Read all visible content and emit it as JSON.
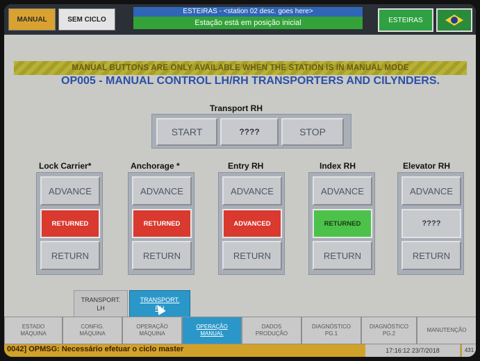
{
  "topbar": {
    "manual_label": "MANUAL",
    "sem_ciclo_label": "SEM CICLO",
    "title_line1": "ESTEIRAS - <station 02 desc. goes here>",
    "title_line2": "Estação está em posição inicial",
    "esteiras_label": "ESTEIRAS",
    "flag_icon": "brazil-flag-icon"
  },
  "warning": "MANUAL BUTTONS ARE ONLY AVAILABLE WHEN THE STATION IS IN MANUAL MODE",
  "page_title": "OP005 - MANUAL CONTROL LH/RH TRANSPORTERS AND CILYNDERS.",
  "transport": {
    "title": "Transport RH",
    "start_label": "START",
    "state_label": "????",
    "stop_label": "STOP"
  },
  "columns": [
    {
      "title": "Lock Carrier*",
      "advance": "ADVANCE",
      "state": "RETURNED",
      "state_color": "#d9392e",
      "return": "RETURN"
    },
    {
      "title": "Anchorage *",
      "advance": "ADVANCE",
      "state": "RETURNED",
      "state_color": "#d9392e",
      "return": "RETURN"
    },
    {
      "title": "Entry  RH",
      "advance": "ADVANCE",
      "state": "ADVANCED",
      "state_color": "#d9392e",
      "return": "RETURN"
    },
    {
      "title": "Index RH",
      "advance": "ADVANCE",
      "state": "RETURNED",
      "state_color": "#4cc24a",
      "return": "RETURN"
    },
    {
      "title": "Elevator RH",
      "advance": "ADVANCE",
      "state": "????",
      "state_color": "#c7c9cc",
      "return": "RETURN"
    }
  ],
  "subtabs": {
    "lh": {
      "line1": "TRANSPORT.",
      "line2": "LH"
    },
    "rh": {
      "line1": "TRANSPORT.",
      "line2": "RH"
    }
  },
  "nav": [
    {
      "line1": "ESTADO",
      "line2": "MÁQUINA",
      "active": false
    },
    {
      "line1": "CONFIG.",
      "line2": "MÁQUINA",
      "active": false
    },
    {
      "line1": "OPERAÇÃO",
      "line2": "MÁQUINA",
      "active": false
    },
    {
      "line1": "OPERAÇÃO",
      "line2": "MANUAL",
      "active": true
    },
    {
      "line1": "DADOS",
      "line2": "PRODUÇÃO",
      "active": false
    },
    {
      "line1": "DIAGNÓSTICO",
      "line2": "PG.1",
      "active": false
    },
    {
      "line1": "DIAGNÓSTICO",
      "line2": "PG.2",
      "active": false
    },
    {
      "line1": "MANUTENÇÃO",
      "line2": "",
      "active": false
    }
  ],
  "status": {
    "message": "0042] OPMSG: Necessário efetuar o ciclo master",
    "datetime": "17:16:12 23/7/2018",
    "number": "431"
  },
  "colors": {
    "accent_blue": "#2b97c9",
    "status_yellow": "#d1a229",
    "returned_red": "#d9392e",
    "returned_green": "#4cc24a"
  }
}
